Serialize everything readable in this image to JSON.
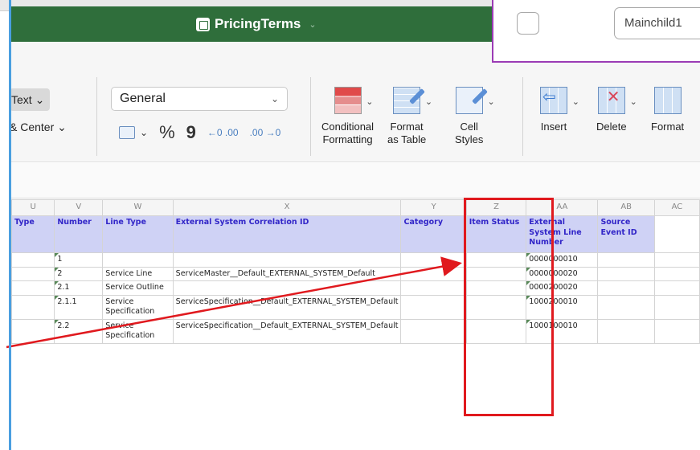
{
  "window": {
    "title": "PricingTerms"
  },
  "ribbon": {
    "wrap_text_label": "Text",
    "merge_center_label": "& Center",
    "number_format": "General",
    "percent_symbol": "%",
    "comma_symbol": "9",
    "increase_decimal": "←0 .00",
    "decrease_decimal": ".00 →0",
    "conditional_formatting_label1": "Conditional",
    "conditional_formatting_label2": "Formatting",
    "format_table_label1": "Format",
    "format_table_label2": "as Table",
    "cell_styles_label1": "Cell",
    "cell_styles_label2": "Styles",
    "insert_label": "Insert",
    "delete_label": "Delete",
    "format_label": "Format"
  },
  "sheet": {
    "columns": [
      "U",
      "V",
      "W",
      "X",
      "Y",
      "Z",
      "AA",
      "AB",
      "AC"
    ],
    "headers": [
      "Type",
      "Number",
      "Line Type",
      "External System Correlation ID",
      "Category",
      "Item Status",
      "External System Line Number",
      "Source Event ID",
      ""
    ],
    "rows": [
      [
        "",
        "1",
        "",
        "",
        "",
        "",
        "0000000010",
        "",
        ""
      ],
      [
        "",
        "2",
        "Service Line",
        "ServiceMaster__Default_EXTERNAL_SYSTEM_Default",
        "",
        "",
        "0000000020",
        "",
        ""
      ],
      [
        "",
        "2.1",
        "Service Outline",
        "",
        "",
        "",
        "0000200020",
        "",
        ""
      ],
      [
        "",
        "2.1.1",
        "Service Specification",
        "ServiceSpecification__Default_EXTERNAL_SYSTEM_Default",
        "",
        "",
        "1000200010",
        "",
        ""
      ],
      [
        "",
        "2.2",
        "Service Specification",
        "ServiceSpecification__Default_EXTERNAL_SYSTEM_Default",
        "",
        "",
        "1000100010",
        "",
        ""
      ]
    ]
  },
  "overlay": {
    "input_value": "Mainchild1"
  },
  "colors": {
    "title_bar": "#2f6e3b",
    "header_fill": "#cfd2f5",
    "header_text": "#3226c8",
    "highlight": "#e0191e",
    "overlay_border": "#9b3bb5"
  }
}
